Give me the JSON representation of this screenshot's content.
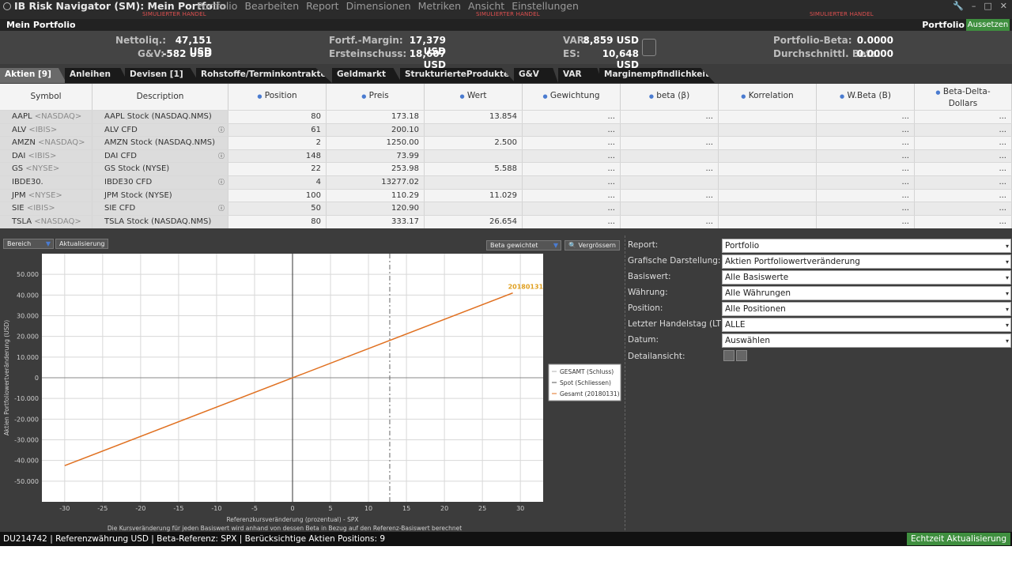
{
  "app": {
    "title": "IB Risk Navigator (SM): Mein Portfolio",
    "menu": [
      "Portfolio",
      "Bearbeiten",
      "Report",
      "Dimensionen",
      "Metriken",
      "Ansicht",
      "Einstellungen"
    ],
    "sim_label": "SIMULIERTER HANDEL"
  },
  "portfolio_bar": {
    "title": "Mein Portfolio",
    "label": "Portfolio",
    "suspend_button": "Aussetzen"
  },
  "summary": {
    "nettoliq_label": "Nettoliq.:",
    "nettoliq_value": "47,151 USD",
    "gv_label": "G&V:",
    "gv_value": "-582 USD",
    "fortf_label": "Fortf.-Margin:",
    "fortf_value": "17,379 USD",
    "erst_label": "Ersteinschuss:",
    "erst_value": "18,607 USD",
    "var_label": "VAR:",
    "var_value": "8,859 USD",
    "es_label": "ES:",
    "es_value": "10,648 USD",
    "beta_label": "Portfolio-Beta:",
    "beta_value": "0.0000",
    "dbeta_label": "Durchschnittl. Beta:",
    "dbeta_value": "0.0000"
  },
  "tabs": [
    "Aktien [9]",
    "Anleihen",
    "Devisen [1]",
    "Rohstoffe/Terminkontrakte",
    "Geldmarkt",
    "StrukturierteProdukte",
    "G&V",
    "VAR",
    "Marginempfindlichkeit"
  ],
  "table": {
    "headers": [
      "Symbol",
      "Description",
      "Position",
      "Preis",
      "Wert",
      "Gewichtung",
      "beta (β)",
      "Korrelation",
      "W.Beta (B)",
      "Beta-Delta-",
      "Dollars"
    ],
    "rows": [
      {
        "sym": "AAPL",
        "exch": "<NASDAQ>",
        "desc": "AAPL Stock (NASDAQ.NMS)",
        "pos": "80",
        "preis": "173.18",
        "wert": "13.854",
        "gew": "...",
        "beta": "...",
        "wb": "...",
        "bdd": "..."
      },
      {
        "sym": "ALV",
        "exch": "<IBIS>",
        "desc": "ALV CFD",
        "pos": "61",
        "preis": "200.10",
        "wert": "",
        "gew": "...",
        "beta": "",
        "wb": "...",
        "bdd": "..."
      },
      {
        "sym": "AMZN",
        "exch": "<NASDAQ>",
        "desc": "AMZN Stock (NASDAQ.NMS)",
        "pos": "2",
        "preis": "1250.00",
        "wert": "2.500",
        "gew": "...",
        "beta": "...",
        "wb": "...",
        "bdd": "..."
      },
      {
        "sym": "DAI",
        "exch": "<IBIS>",
        "desc": "DAI CFD",
        "pos": "148",
        "preis": "73.99",
        "wert": "",
        "gew": "...",
        "beta": "",
        "wb": "...",
        "bdd": "..."
      },
      {
        "sym": "GS",
        "exch": "<NYSE>",
        "desc": "GS Stock (NYSE)",
        "pos": "22",
        "preis": "253.98",
        "wert": "5.588",
        "gew": "...",
        "beta": "...",
        "wb": "...",
        "bdd": "..."
      },
      {
        "sym": "IBDE30.",
        "exch": "",
        "desc": "IBDE30 CFD",
        "pos": "4",
        "preis": "13277.02",
        "wert": "",
        "gew": "...",
        "beta": "",
        "wb": "...",
        "bdd": "..."
      },
      {
        "sym": "JPM",
        "exch": "<NYSE>",
        "desc": "JPM Stock (NYSE)",
        "pos": "100",
        "preis": "110.29",
        "wert": "11.029",
        "gew": "...",
        "beta": "...",
        "wb": "...",
        "bdd": "..."
      },
      {
        "sym": "SIE",
        "exch": "<IBIS>",
        "desc": "SIE CFD",
        "pos": "50",
        "preis": "120.90",
        "wert": "",
        "gew": "...",
        "beta": "",
        "wb": "...",
        "bdd": "..."
      },
      {
        "sym": "TSLA",
        "exch": "<NASDAQ>",
        "desc": "TSLA Stock (NASDAQ.NMS)",
        "pos": "80",
        "preis": "333.17",
        "wert": "26.654",
        "gew": "...",
        "beta": "...",
        "wb": "...",
        "bdd": "..."
      }
    ]
  },
  "chart_tools": {
    "bereich": "Bereich",
    "aktualisierung": "Aktualisierung",
    "beta_weighted": "Beta gewichtet",
    "zoom": "Vergrössern"
  },
  "chart_data": {
    "type": "line",
    "ylabel": "Aktien Portfoliowertveränderung (USD)",
    "xlabel": "Referenzkursveränderung (prozentual) - SPX",
    "footnote": "Die Kursveränderung für jeden Basiswert wird anhand von dessen Beta in Bezug auf den Referenz-Basiswert berechnet",
    "xlim": [
      -33,
      33
    ],
    "ylim": [
      -60000,
      60000
    ],
    "xticks": [
      -30,
      -25,
      -20,
      -15,
      -10,
      -5,
      0,
      5,
      10,
      15,
      20,
      25,
      30
    ],
    "yticks": [
      50000,
      40000,
      30000,
      20000,
      10000,
      0,
      -10000,
      -20000,
      -30000,
      -40000,
      -50000
    ],
    "ytick_labels": [
      "50.000",
      "40.000",
      "30.000",
      "20.000",
      "10.000",
      "0",
      "-10.000",
      "-20.000",
      "-30.000",
      "-40.000",
      "-50.000"
    ],
    "series": [
      {
        "name": "GESAMT (Schluss)",
        "color": "#b0b0b0",
        "x": [],
        "y": []
      },
      {
        "name": "Spot (Schliessen)",
        "color": "#555555",
        "x": [],
        "y": []
      },
      {
        "name": "Gesamt (20180131)",
        "color": "#e07020",
        "x": [
          -30,
          29
        ],
        "y": [
          -42500,
          41000
        ]
      }
    ],
    "annotation": "20180131",
    "vline_x": 12.8,
    "grid": true,
    "legend": "middle-right"
  },
  "right_pane": {
    "fields": [
      {
        "label": "Report:",
        "value": "Portfolio"
      },
      {
        "label": "Grafische Darstellung:",
        "value": "Aktien Portfoliowertveränderung"
      },
      {
        "label": "Basiswert:",
        "value": "Alle Basiswerte"
      },
      {
        "label": "Währung:",
        "value": "Alle Währungen"
      },
      {
        "label": "Position:",
        "value": "Alle Positionen"
      },
      {
        "label": "Letzter Handelstag (LTD):",
        "value": "ALLE"
      },
      {
        "label": "Datum:",
        "value": "Auswählen"
      }
    ],
    "detail_label": "Detailansicht:"
  },
  "status": {
    "text": "DU214742  |  Referenzwährung USD  |  Beta-Referenz:  SPX  |  Berücksichtige Aktien Positions: 9",
    "live_button": "Echtzeit Aktualisierung"
  }
}
